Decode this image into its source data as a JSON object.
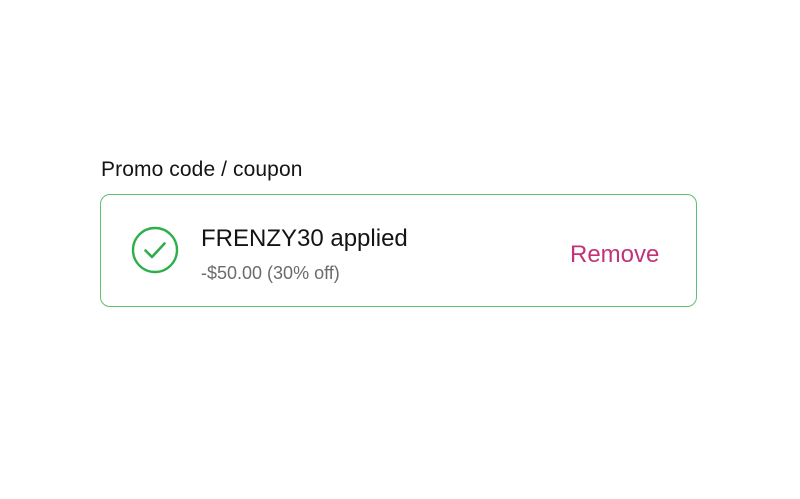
{
  "promo": {
    "label": "Promo code / coupon",
    "code_applied_text": "FRENZY30 applied",
    "discount_text": "-$50.00 (30% off)",
    "remove_label": "Remove",
    "status_icon": "check-circle-icon"
  },
  "colors": {
    "success": "#2fae4e",
    "box_border": "#5cbf73",
    "remove": "#c2347a",
    "muted_text": "#6b6b6b",
    "text": "#141414"
  }
}
